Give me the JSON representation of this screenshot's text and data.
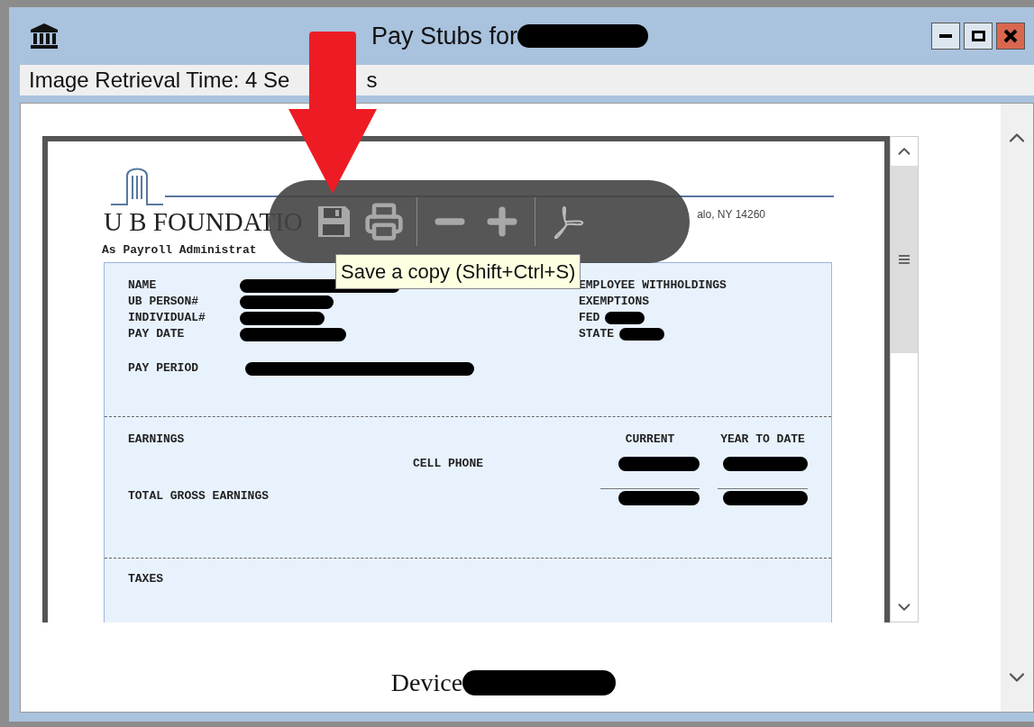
{
  "window": {
    "title": "Pay Stubs for"
  },
  "info_bar": {
    "text_start": "Image Retrieval Time: 4 Se",
    "text_end": "s"
  },
  "document": {
    "letterhead": "U B FOUNDATIO",
    "address": "alo, NY  14260",
    "subtitle": "As Payroll Administrat",
    "employee_fields": [
      "NAME",
      "UB PERSON#",
      "INDIVIDUAL#",
      "PAY DATE"
    ],
    "pay_period_label": "PAY PERIOD",
    "withholdings": {
      "title": "EMPLOYEE WITHHOLDINGS",
      "exemptions": "EXEMPTIONS",
      "fields": [
        "FED",
        "STATE"
      ]
    },
    "earnings": {
      "title": "EARNINGS",
      "columns": [
        "CURRENT",
        "YEAR TO DATE"
      ],
      "rows": [
        {
          "label": "CELL PHONE",
          "kind": "item"
        },
        {
          "label": "TOTAL GROSS EARNINGS",
          "kind": "total"
        }
      ]
    },
    "taxes_title": "TAXES"
  },
  "toolbar": {
    "buttons": [
      {
        "kind": "save"
      },
      {
        "kind": "print"
      },
      {
        "kind": "zoom_out"
      },
      {
        "kind": "zoom_in"
      },
      {
        "kind": "acrobat"
      }
    ]
  },
  "tooltip": "Save a copy (Shift+Ctrl+S)",
  "footer": {
    "label": "Device"
  }
}
